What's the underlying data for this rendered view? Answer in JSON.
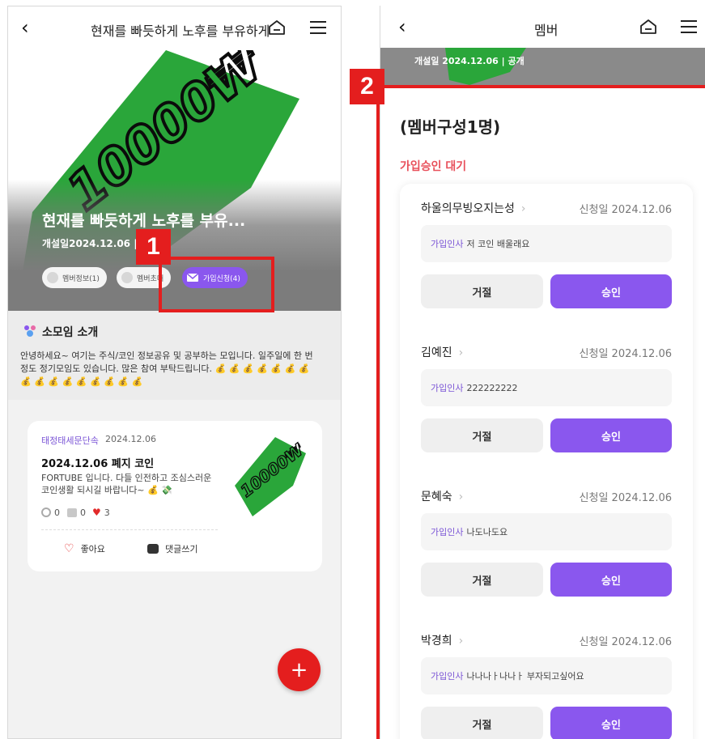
{
  "left": {
    "header_title": "현재를 빠듯하게 노후를 부유하게",
    "hero_title": "현재를 빠듯하게 노후를 부유...",
    "hero_meta": "개설일2024.12.06  |        1명",
    "pills": [
      {
        "label": "멤버정보(1)"
      },
      {
        "label": "멤버초대"
      },
      {
        "label": "가입신청(4)"
      }
    ],
    "intro": {
      "heading": "소모임 소개",
      "body": "안녕하세요~ 여기는 주식/코인 정보공유 및 공부하는 모입니다. 일주일에 한 번정도 정기모임도 있습니다. 많은 참여 부탁드립니다. 💰 💰 💰 💰 💰 💰 💰 💰 💰 💰 💰 💰 💰 💰 💰 💰"
    },
    "post": {
      "category": "태정태세문단속",
      "date": "2024.12.06",
      "title": "2024.12.06 폐지 코인",
      "text": "FORTUBE 입니다. 다들 인전하고 조심스러운 코인생활 되시길 바랍니다~ 💰 💸",
      "views": "0",
      "comments": "0",
      "likes": "3",
      "like_label": "좋아요",
      "comment_label": "댓글쓰기"
    },
    "fab_label": "+",
    "marker": "1",
    "banner_text": "10000₩"
  },
  "right": {
    "header_title": "멤버",
    "strip_text": "개설일 2024.12.06  |  공개",
    "title": "(멤버구성1명)",
    "subtitle": "가입승인 대기",
    "marker": "2",
    "applicants": [
      {
        "name": "하울의무빙오지는성",
        "date": "신청일 2024.12.06",
        "msg_label": "가입인사",
        "msg": "저 코인 배울래요",
        "reject": "거절",
        "approve": "승인"
      },
      {
        "name": "김예진",
        "date": "신청일 2024.12.06",
        "msg_label": "가입인사",
        "msg": "222222222",
        "reject": "거절",
        "approve": "승인"
      },
      {
        "name": "문혜숙",
        "date": "신청일 2024.12.06",
        "msg_label": "가입인사",
        "msg": "나도나도요",
        "reject": "거절",
        "approve": "승인"
      },
      {
        "name": "박경희",
        "date": "신청일 2024.12.06",
        "msg_label": "가입인사",
        "msg": "나나나ㅏ나나ㅏ 부자되고싶어요",
        "reject": "거절",
        "approve": "승인"
      }
    ]
  },
  "icons": {
    "back": "chevron-left-icon",
    "home": "home-icon",
    "menu": "hamburger-menu-icon"
  },
  "colors": {
    "accent_purple": "#8a57ee",
    "accent_red": "#e41e1e",
    "banner_green": "#2aa63a"
  }
}
